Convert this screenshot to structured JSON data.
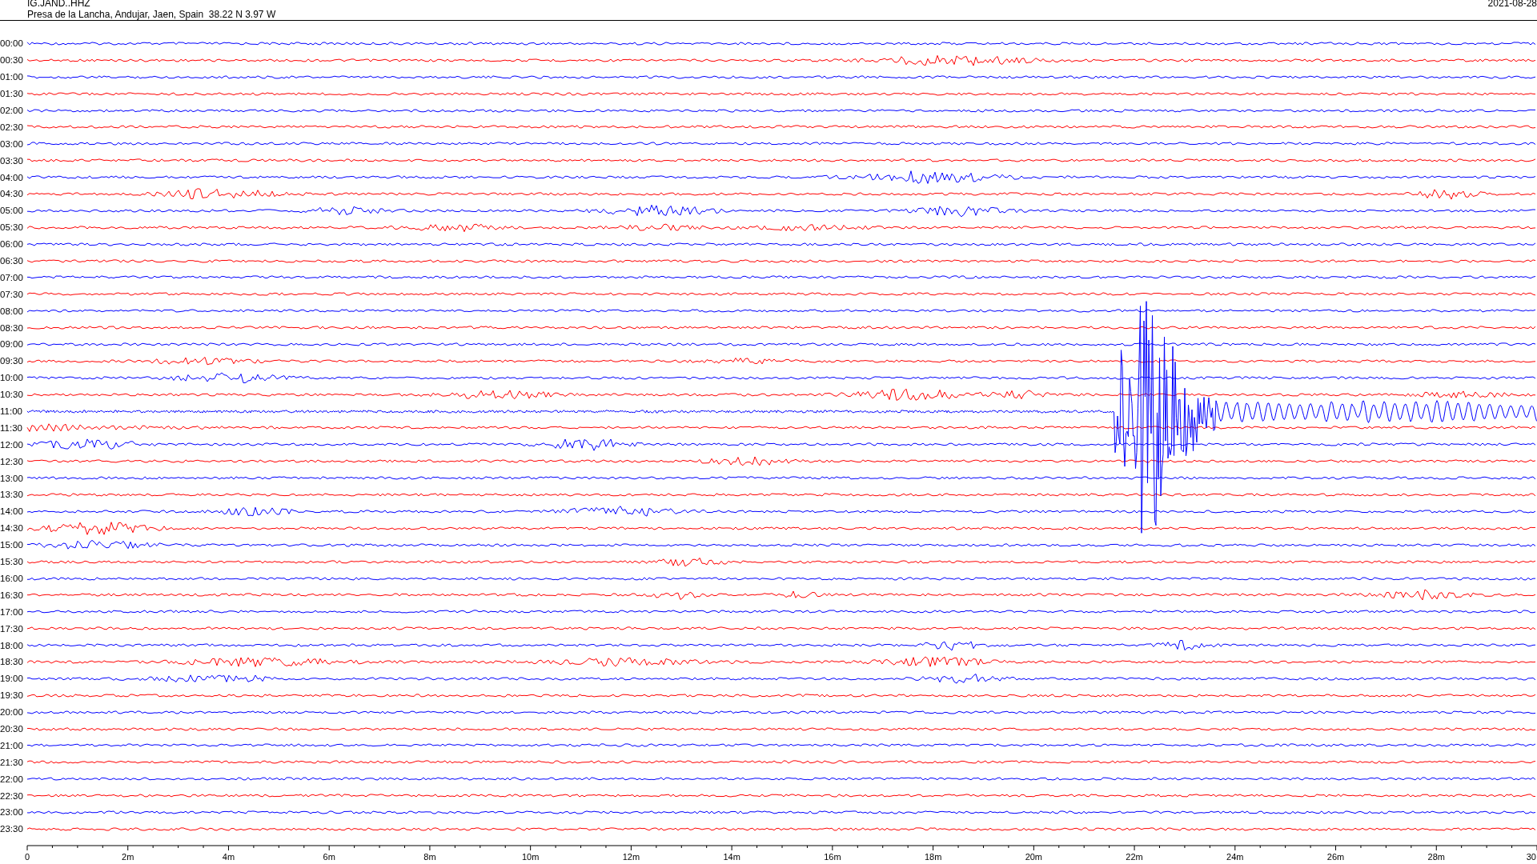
{
  "header": {
    "station": "IG.JAND..HHZ",
    "location": "Presa de la Lancha, Andujar, Jaen, Spain  38.22 N 3.97 W",
    "date": "2021-08-28"
  },
  "rows": [
    {
      "label": "00:00",
      "color": "#0000ff"
    },
    {
      "label": "00:30",
      "color": "#ff0000"
    },
    {
      "label": "01:00",
      "color": "#0000ff"
    },
    {
      "label": "01:30",
      "color": "#ff0000"
    },
    {
      "label": "02:00",
      "color": "#0000ff"
    },
    {
      "label": "02:30",
      "color": "#ff0000"
    },
    {
      "label": "03:00",
      "color": "#0000ff"
    },
    {
      "label": "03:30",
      "color": "#ff0000"
    },
    {
      "label": "04:00",
      "color": "#0000ff"
    },
    {
      "label": "04:30",
      "color": "#ff0000"
    },
    {
      "label": "05:00",
      "color": "#0000ff"
    },
    {
      "label": "05:30",
      "color": "#ff0000"
    },
    {
      "label": "06:00",
      "color": "#0000ff"
    },
    {
      "label": "06:30",
      "color": "#ff0000"
    },
    {
      "label": "07:00",
      "color": "#0000ff"
    },
    {
      "label": "07:30",
      "color": "#ff0000"
    },
    {
      "label": "08:00",
      "color": "#0000ff"
    },
    {
      "label": "08:30",
      "color": "#ff0000"
    },
    {
      "label": "09:00",
      "color": "#0000ff"
    },
    {
      "label": "09:30",
      "color": "#ff0000"
    },
    {
      "label": "10:00",
      "color": "#0000ff"
    },
    {
      "label": "10:30",
      "color": "#ff0000"
    },
    {
      "label": "11:00",
      "color": "#0000ff"
    },
    {
      "label": "11:30",
      "color": "#ff0000"
    },
    {
      "label": "12:00",
      "color": "#0000ff"
    },
    {
      "label": "12:30",
      "color": "#ff0000"
    },
    {
      "label": "13:00",
      "color": "#0000ff"
    },
    {
      "label": "13:30",
      "color": "#ff0000"
    },
    {
      "label": "14:00",
      "color": "#0000ff"
    },
    {
      "label": "14:30",
      "color": "#ff0000"
    },
    {
      "label": "15:00",
      "color": "#0000ff"
    },
    {
      "label": "15:30",
      "color": "#ff0000"
    },
    {
      "label": "16:00",
      "color": "#0000ff"
    },
    {
      "label": "16:30",
      "color": "#ff0000"
    },
    {
      "label": "17:00",
      "color": "#0000ff"
    },
    {
      "label": "17:30",
      "color": "#ff0000"
    },
    {
      "label": "18:00",
      "color": "#0000ff"
    },
    {
      "label": "18:30",
      "color": "#ff0000"
    },
    {
      "label": "19:00",
      "color": "#0000ff"
    },
    {
      "label": "19:30",
      "color": "#ff0000"
    },
    {
      "label": "20:00",
      "color": "#0000ff"
    },
    {
      "label": "20:30",
      "color": "#ff0000"
    },
    {
      "label": "21:00",
      "color": "#0000ff"
    },
    {
      "label": "21:30",
      "color": "#ff0000"
    },
    {
      "label": "22:00",
      "color": "#0000ff"
    },
    {
      "label": "22:30",
      "color": "#ff0000"
    },
    {
      "label": "23:00",
      "color": "#0000ff"
    },
    {
      "label": "23:30",
      "color": "#ff0000"
    }
  ],
  "axis": {
    "labels": [
      "0",
      "2m",
      "4m",
      "6m",
      "8m",
      "10m",
      "12m",
      "14m",
      "16m",
      "18m",
      "20m",
      "22m",
      "24m",
      "26m",
      "28m",
      "30"
    ]
  }
}
